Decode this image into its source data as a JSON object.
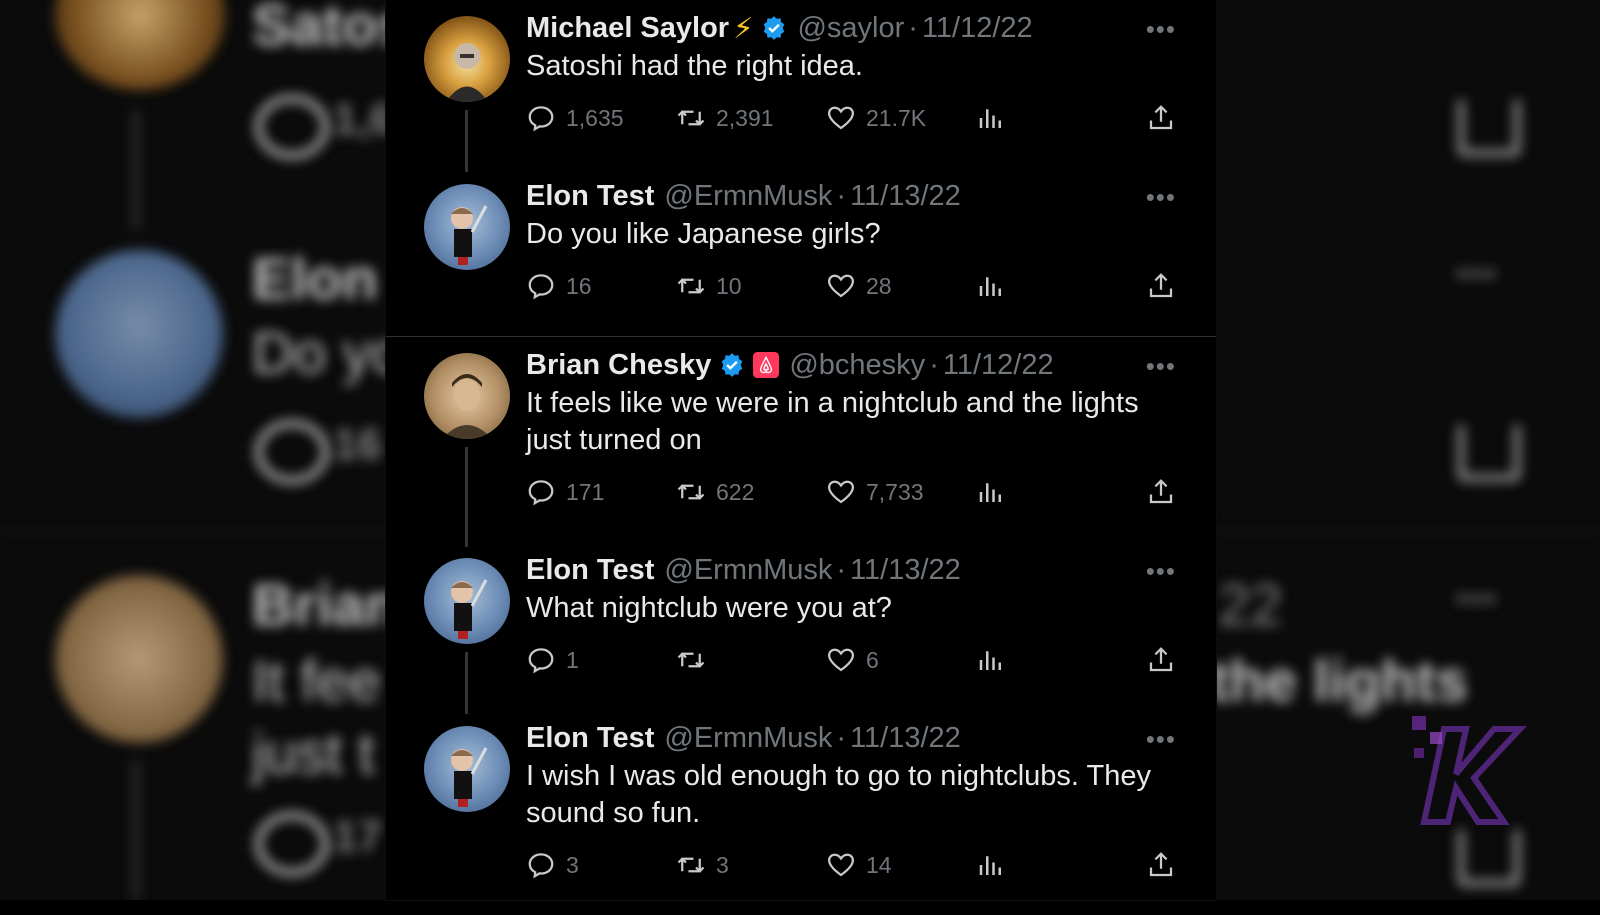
{
  "watermark": {
    "letter": "K",
    "color": "#5a2a8a"
  },
  "background": {
    "left_fragments": [
      "Satos",
      "Elon",
      "Do yo",
      "Brian",
      "It fee",
      "just t"
    ],
    "left_counts": [
      "1,6",
      "16",
      "17"
    ],
    "right_fragments": [
      "22",
      "the lights"
    ]
  },
  "tweets": [
    {
      "name": "Michael Saylor",
      "emoji": "⚡",
      "verified": true,
      "handle": "@saylor",
      "date": "11/12/22",
      "text": "Satoshi had the right idea.",
      "replies": "1,635",
      "retweets": "2,391",
      "likes": "21.7K"
    },
    {
      "name": "Elon Test",
      "handle": "@ErmnMusk",
      "date": "11/13/22",
      "text": "Do you like Japanese girls?",
      "replies": "16",
      "retweets": "10",
      "likes": "28"
    },
    {
      "name": "Brian Chesky",
      "verified": true,
      "affiliate": "airbnb",
      "handle": "@bchesky",
      "date": "11/12/22",
      "text": "It feels like we were in a nightclub and the lights just turned on",
      "replies": "171",
      "retweets": "622",
      "likes": "7,733"
    },
    {
      "name": "Elon Test",
      "handle": "@ErmnMusk",
      "date": "11/13/22",
      "text": "What nightclub were you at?",
      "replies": "1",
      "retweets": "",
      "likes": "6"
    },
    {
      "name": "Elon Test",
      "handle": "@ErmnMusk",
      "date": "11/13/22",
      "text": "I wish I was old enough to go to nightclubs. They sound so fun.",
      "replies": "3",
      "retweets": "3",
      "likes": "14"
    }
  ],
  "ui": {
    "more": "•••",
    "dot": "·"
  },
  "colors": {
    "verified": "#1d9bf0",
    "airbnb": "#ff385c",
    "muted": "#71767b"
  }
}
